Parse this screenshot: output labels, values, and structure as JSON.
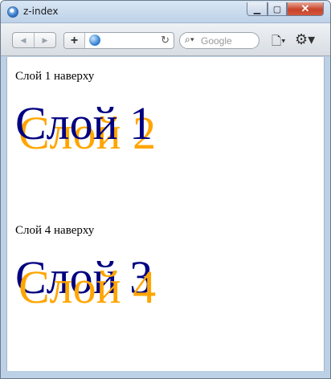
{
  "window": {
    "title": "z-index"
  },
  "toolbar": {
    "back_icon": "◀",
    "forward_icon": "▶",
    "add_icon": "+",
    "reload_icon": "↻",
    "search_placeholder": "Google",
    "search_icon": "🔍",
    "page_icon": "📄",
    "settings_icon": "⚙"
  },
  "content": {
    "caption_1": "Слой 1 наверху",
    "layer_1": "Слой 1",
    "layer_2": "Слой 2",
    "caption_2": "Слой 4 наверху",
    "layer_3": "Слой 3",
    "layer_4": "Слой 4"
  },
  "colors": {
    "dark_layer": "#000080",
    "orange_layer": "#ffa500"
  }
}
